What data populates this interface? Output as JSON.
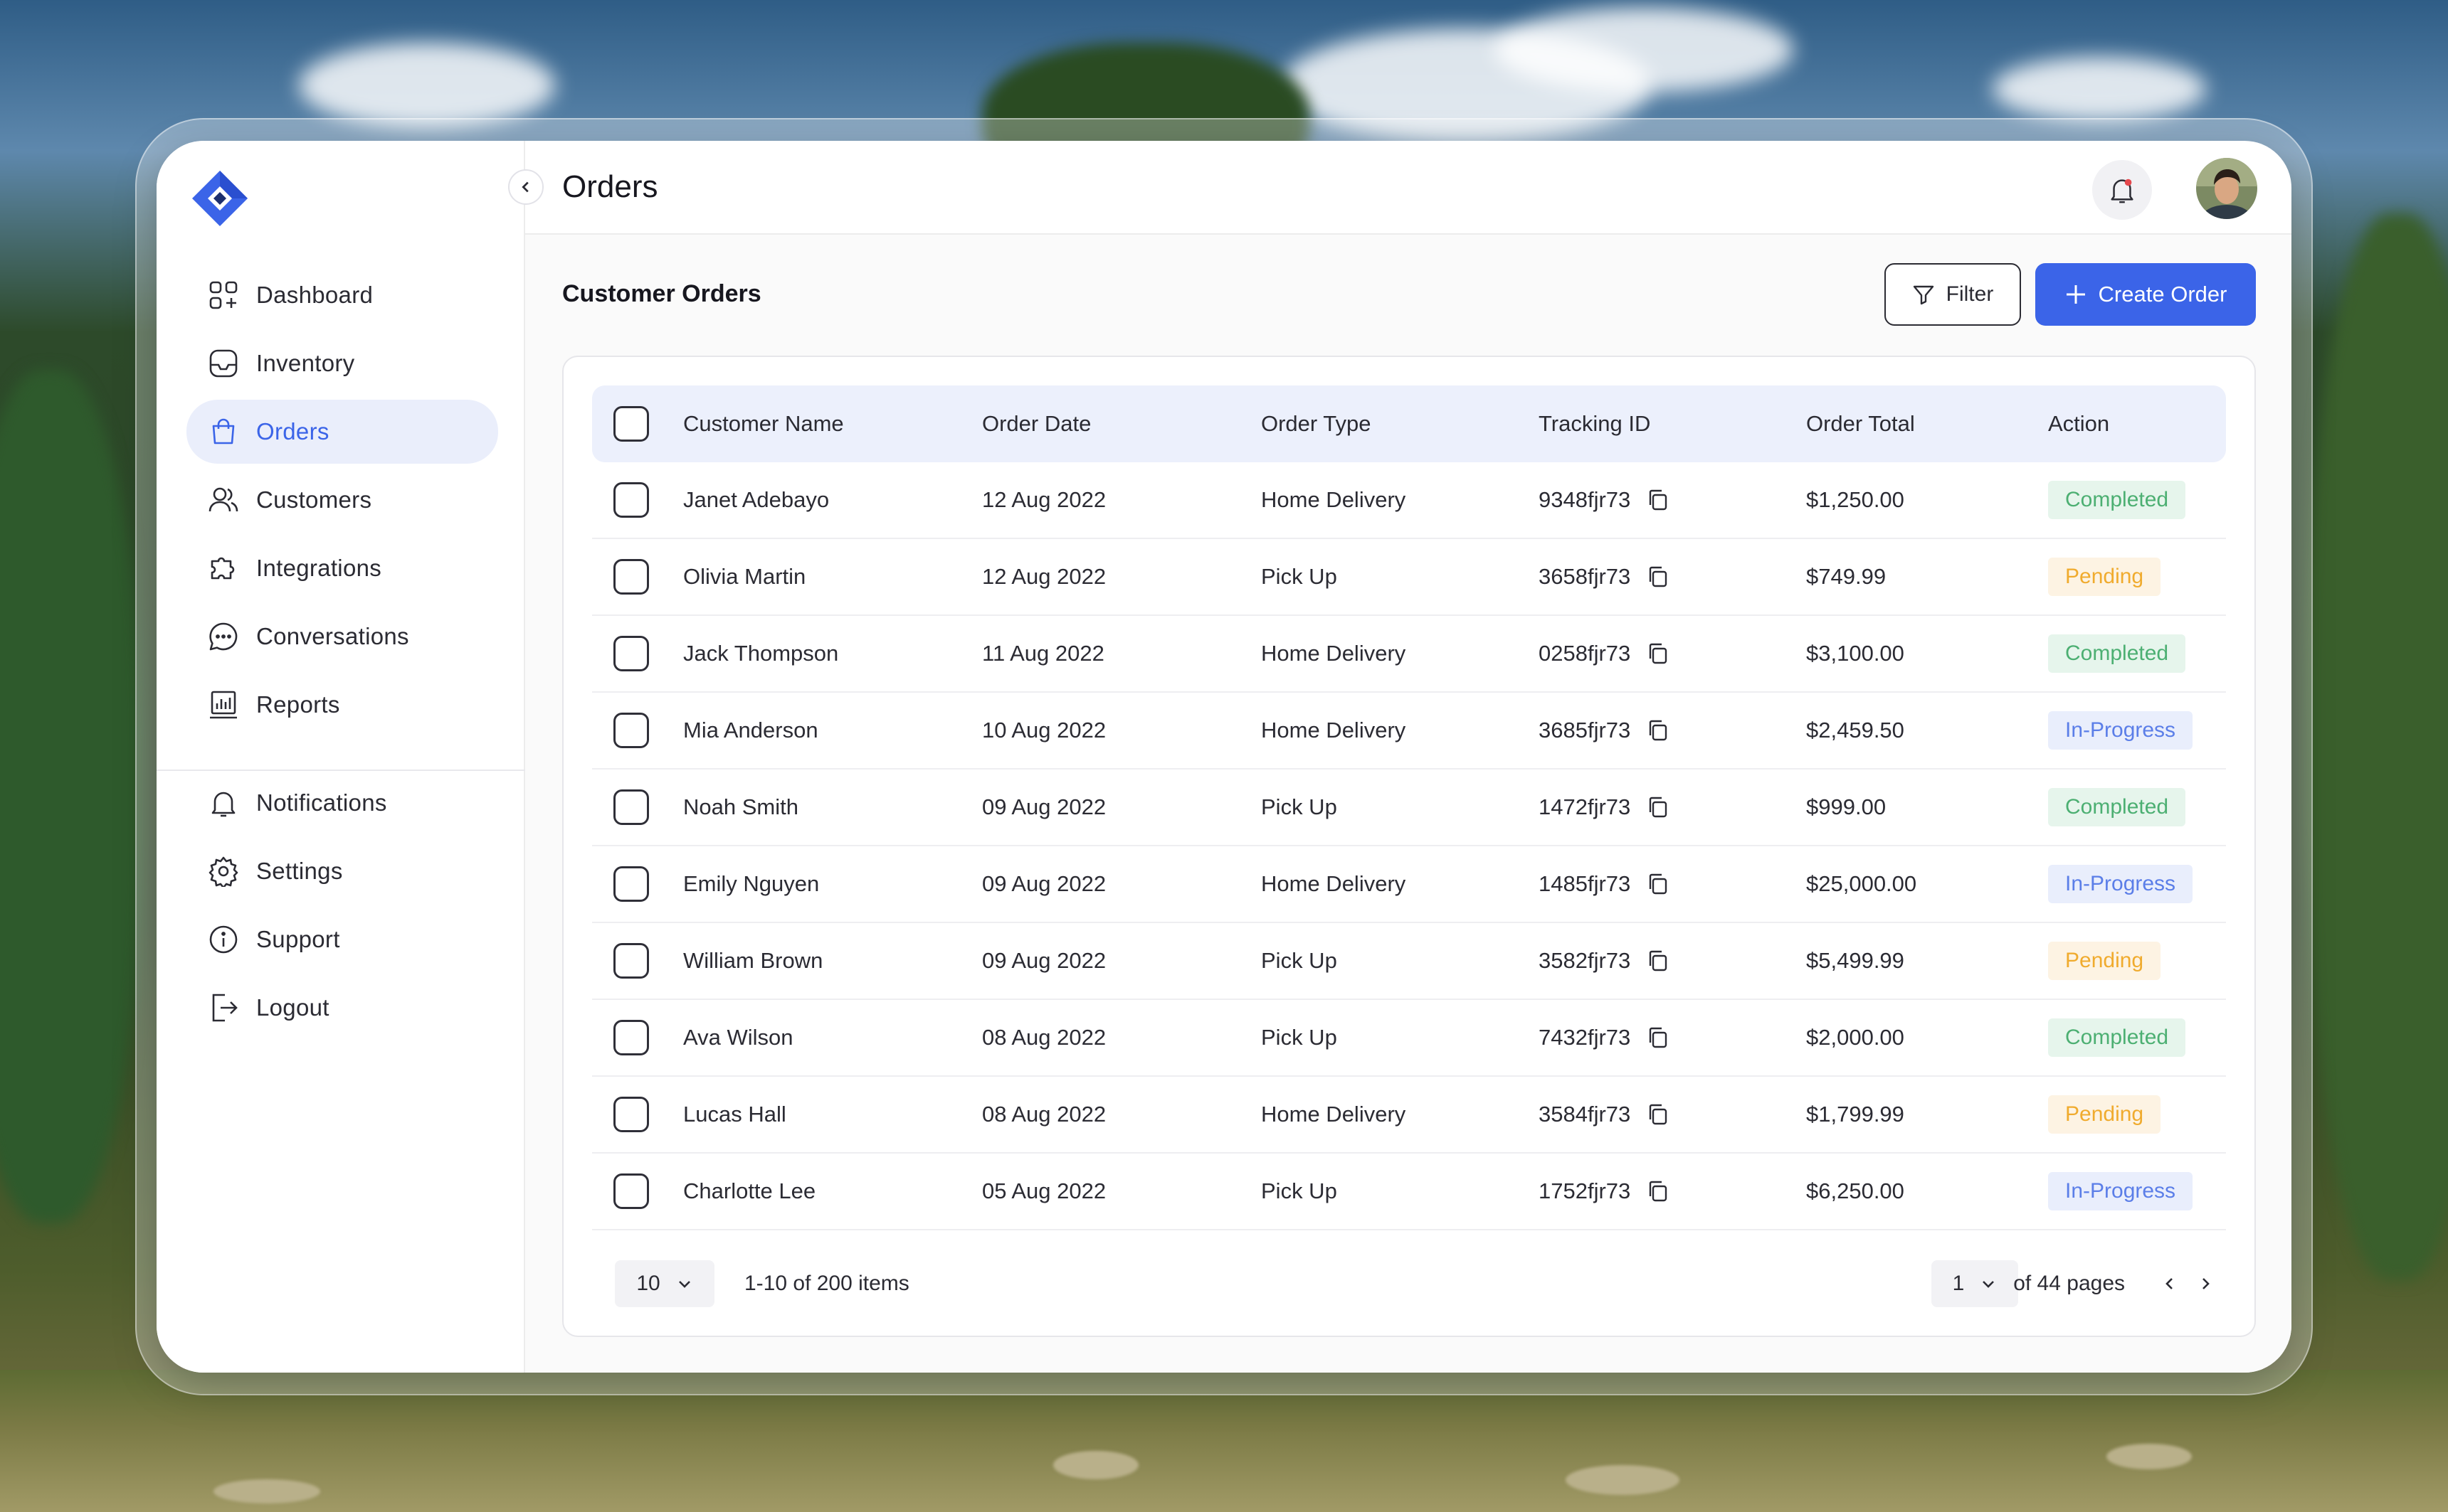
{
  "app": {
    "title": "Orders"
  },
  "sidebar": {
    "primary": [
      {
        "label": "Dashboard",
        "icon": "dashboard-icon"
      },
      {
        "label": "Inventory",
        "icon": "inventory-icon"
      },
      {
        "label": "Orders",
        "icon": "shopping-bag-icon",
        "active": true
      },
      {
        "label": "Customers",
        "icon": "users-icon"
      },
      {
        "label": "Integrations",
        "icon": "puzzle-icon"
      },
      {
        "label": "Conversations",
        "icon": "chat-icon"
      },
      {
        "label": "Reports",
        "icon": "bar-chart-icon"
      }
    ],
    "secondary": [
      {
        "label": "Notifications",
        "icon": "bell-icon"
      },
      {
        "label": "Settings",
        "icon": "gear-icon"
      },
      {
        "label": "Support",
        "icon": "info-icon"
      },
      {
        "label": "Logout",
        "icon": "logout-icon"
      }
    ]
  },
  "main": {
    "section_title": "Customer Orders",
    "filter_label": "Filter",
    "create_label": "Create Order",
    "columns": [
      "Customer Name",
      "Order Date",
      "Order Type",
      "Tracking ID",
      "Order Total",
      "Action"
    ],
    "rows": [
      {
        "name": "Janet Adebayo",
        "date": "12 Aug 2022",
        "type": "Home Delivery",
        "tracking": "9348fjr73",
        "total": "$1,250.00",
        "status": "Completed"
      },
      {
        "name": "Olivia Martin",
        "date": "12 Aug 2022",
        "type": "Pick Up",
        "tracking": "3658fjr73",
        "total": "$749.99",
        "status": "Pending"
      },
      {
        "name": "Jack Thompson",
        "date": "11 Aug 2022",
        "type": "Home Delivery",
        "tracking": "0258fjr73",
        "total": "$3,100.00",
        "status": "Completed"
      },
      {
        "name": "Mia Anderson",
        "date": "10 Aug 2022",
        "type": "Home Delivery",
        "tracking": "3685fjr73",
        "total": "$2,459.50",
        "status": "In-Progress"
      },
      {
        "name": "Noah Smith",
        "date": "09 Aug 2022",
        "type": "Pick Up",
        "tracking": "1472fjr73",
        "total": "$999.00",
        "status": "Completed"
      },
      {
        "name": "Emily Nguyen",
        "date": "09 Aug 2022",
        "type": "Home Delivery",
        "tracking": "1485fjr73",
        "total": "$25,000.00",
        "status": "In-Progress"
      },
      {
        "name": "William Brown",
        "date": "09 Aug 2022",
        "type": "Pick Up",
        "tracking": "3582fjr73",
        "total": "$5,499.99",
        "status": "Pending"
      },
      {
        "name": "Ava Wilson",
        "date": "08 Aug 2022",
        "type": "Pick Up",
        "tracking": "7432fjr73",
        "total": "$2,000.00",
        "status": "Completed"
      },
      {
        "name": "Lucas Hall",
        "date": "08 Aug 2022",
        "type": "Home Delivery",
        "tracking": "3584fjr73",
        "total": "$1,799.99",
        "status": "Pending"
      },
      {
        "name": "Charlotte Lee",
        "date": "05 Aug 2022",
        "type": "Pick Up",
        "tracking": "1752fjr73",
        "total": "$6,250.00",
        "status": "In-Progress"
      }
    ],
    "pagination": {
      "per_page": "10",
      "range": "1-10 of 200 items",
      "current_page": "1",
      "of_pages": "of 44 pages"
    }
  },
  "colors": {
    "accent": "#3b64e8",
    "completed_bg": "#e6f5ec",
    "completed_fg": "#4caf72",
    "pending_bg": "#fdf3e3",
    "pending_fg": "#f0ab2e",
    "progress_bg": "#e9eefc",
    "progress_fg": "#5b7ee8"
  }
}
